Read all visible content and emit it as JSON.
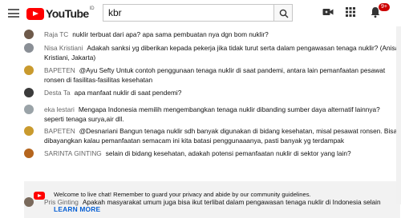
{
  "topbar": {
    "logo_text": "YouTube",
    "logo_country": "ID",
    "search_value": "kbr",
    "notification_count": "9+"
  },
  "messages": [
    {
      "author": "Raja TC",
      "text": "nuklir terbuat dari apa? apa sama pembuatan nya dgn bom nuklir?",
      "avatar_color": "#6e5a4a"
    },
    {
      "author": "Nisa Kristiani",
      "text": "Adakah sanksi yg diberikan kepada pekerja jika tidak turut serta dalam pengawasan tenaga nuklir? (Anisa Kristiani, Jakarta)",
      "avatar_color": "#8a8f96"
    },
    {
      "author": "BAPETEN",
      "text": "@Ayu Sefty Untuk contoh penggunaan tenaga nuklir di saat pandemi, antara lain pemanfaatan pesawat ronsen di fasilitas-fasilitas kesehatan",
      "avatar_color": "#c99a2e"
    },
    {
      "author": "Desta Ta",
      "text": "apa manfaat nuklir di saat pendemi?",
      "avatar_color": "#3b3b3b"
    },
    {
      "author": "eka lestari",
      "text": "Mengapa Indonesia memilih mengembangkan tenaga nuklir dibanding sumber daya alternatif lainnya? seperti tenaga surya,air dll.",
      "avatar_color": "#9aa3a8"
    },
    {
      "author": "BAPETEN",
      "text": "@Desnariani Bangun tenaga nuklir sdh banyak digunakan di bidang kesehatan, misal pesawat ronsen. Bisa dibayangkan kalau pemanfaatan semacam ini kita batasi penggunaaanya, pasti banyak yg terdampak",
      "avatar_color": "#c99a2e"
    },
    {
      "author": "SARINTA GINTING",
      "text": "selain di bidang kesehatan, adakah potensi pemanfaatan nuklir di sektor yang lain?",
      "avatar_color": "#b5651d"
    },
    {
      "author": "Pris Ginting",
      "text": "Apakah masyarakat umum juga bisa ikut terlibat dalam pengawasan tenaga nuklir di Indonesia selain",
      "avatar_color": "#7a6a5c"
    }
  ],
  "notice": {
    "text": "Welcome to live chat! Remember to guard your privacy and abide by our community guidelines.",
    "link": "LEARN MORE"
  }
}
